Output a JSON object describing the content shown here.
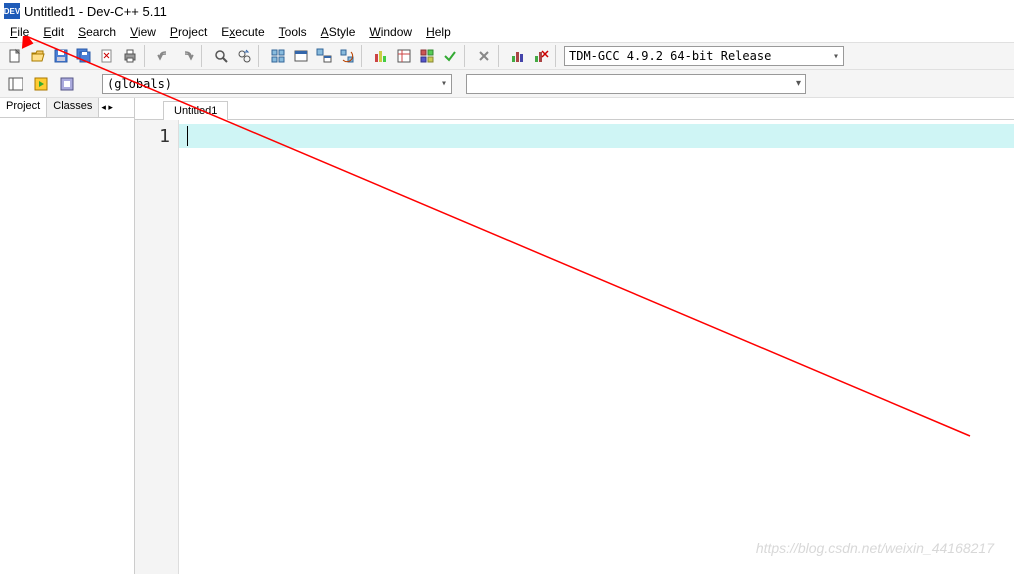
{
  "title": "Untitled1 - Dev-C++ 5.11",
  "app_icon_text": "DEV",
  "menus": {
    "file": "File",
    "edit": "Edit",
    "search": "Search",
    "view": "View",
    "project": "Project",
    "execute": "Execute",
    "tools": "Tools",
    "astyle": "AStyle",
    "window": "Window",
    "help": "Help"
  },
  "compiler_selected": "TDM-GCC 4.9.2 64-bit Release",
  "scope_selected": "(globals)",
  "side_tabs": {
    "project": "Project",
    "classes": "Classes"
  },
  "editor_tab": "Untitled1",
  "line_number": "1",
  "watermark": "https://blog.csdn.net/weixin_44168217"
}
